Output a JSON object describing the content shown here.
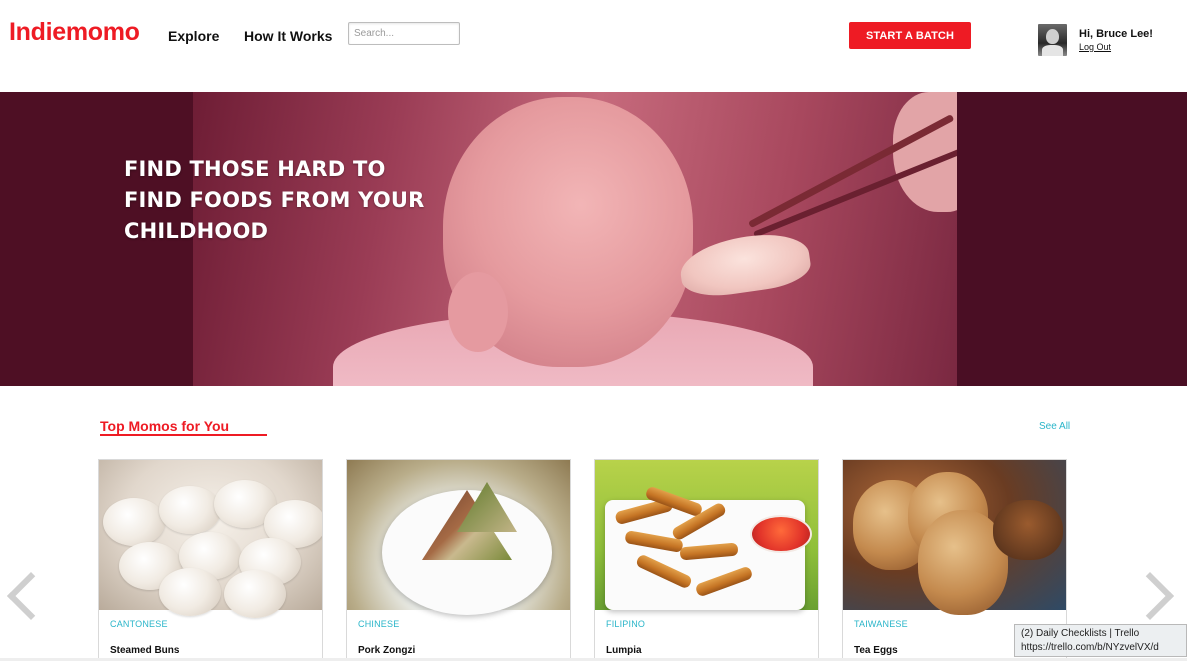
{
  "brand": {
    "logo_text": "Indiemomo",
    "accent_color": "#ee1b24",
    "teal_color": "#2ab5c9"
  },
  "nav": {
    "explore": "Explore",
    "how_it_works": "How It Works",
    "search_placeholder": "Search...",
    "start_batch": "START A BATCH"
  },
  "user": {
    "greeting": "Hi, Bruce Lee!",
    "logout": "Log Out",
    "avatar_icon": "user-avatar"
  },
  "hero": {
    "title": "Find those hard to find foods from your childhood",
    "bg_color": "#4e0f24"
  },
  "section": {
    "title": "Top Momos for You",
    "see_all": "See All"
  },
  "cards": [
    {
      "category": "CANTONESE",
      "name": "Steamed Buns"
    },
    {
      "category": "CHINESE",
      "name": "Pork Zongzi"
    },
    {
      "category": "FILIPINO",
      "name": "Lumpia"
    },
    {
      "category": "TAIWANESE",
      "name": "Tea Eggs"
    }
  ],
  "carousel": {
    "prev_icon": "chevron-left-icon",
    "next_icon": "chevron-right-icon"
  },
  "status_tooltip": {
    "line1": "(2) Daily Checklists | Trello",
    "line2": "https://trello.com/b/NYzvelVX/d"
  }
}
